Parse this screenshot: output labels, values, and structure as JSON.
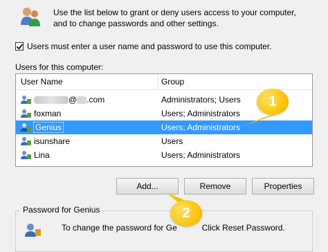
{
  "intro": {
    "line1": "Use the list below to grant or deny users access to your computer,",
    "line2": "and to change passwords and other settings."
  },
  "checkbox": {
    "checked": true,
    "label": "Users must enter a user name and password to use this computer."
  },
  "users_label": "Users for this computer:",
  "columns": {
    "name": "User Name",
    "group": "Group"
  },
  "users": [
    {
      "name_visible": "@",
      "name_suffix": ".com",
      "group": "Administrators; Users",
      "selected": false
    },
    {
      "name": "foxman",
      "group": "Users; Administrators",
      "selected": false
    },
    {
      "name": "Genius",
      "group": "Users; Administrators",
      "selected": true
    },
    {
      "name": "isunshare",
      "group": "Users",
      "selected": false
    },
    {
      "name": "Lina",
      "group": "Users; Administrators",
      "selected": false
    }
  ],
  "buttons": {
    "add": "Add...",
    "remove": "Remove",
    "properties": "Properties"
  },
  "password_group": {
    "title": "Password for Genius",
    "text_start": "To change the password for Ge",
    "text_end": "Click Reset Password."
  },
  "callouts": [
    "1",
    "2"
  ],
  "colors": {
    "selection": "#3399ff",
    "callout": "#f7c200"
  }
}
